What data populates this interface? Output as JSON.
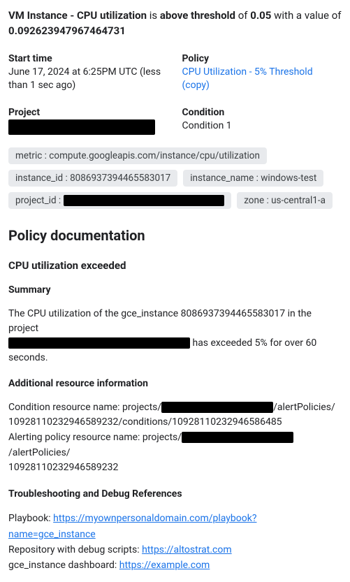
{
  "headline": {
    "metric_name": "VM Instance - CPU utilization",
    "verb": "is",
    "state": "above threshold",
    "of": "of",
    "threshold": "0.05",
    "with": "with a value of",
    "value": "0.092623947967464731"
  },
  "meta": {
    "start_time_label": "Start time",
    "start_time_value": "June 17, 2024 at 6:25PM UTC (less than 1 sec ago)",
    "policy_label": "Policy",
    "policy_value": "CPU Utilization - 5% Threshold (copy)",
    "project_label": "Project",
    "condition_label": "Condition",
    "condition_value": "Condition 1"
  },
  "chips": {
    "metric": "metric : compute.googleapis.com/instance/cpu/utilization",
    "instance_id": "instance_id : 8086937394465583017",
    "instance_name": "instance_name : windows-test",
    "project_id_prefix": "project_id :",
    "zone": "zone : us-central1-a"
  },
  "doc": {
    "heading": "Policy documentation",
    "sub": "CPU utilization exceeded",
    "summary_h": "Summary",
    "summary_p1": "The CPU utilization of the gce_instance 8086937394465583017 in the project",
    "summary_p2": "has exceeded 5% for over 60 seconds.",
    "addl_h": "Additional resource information",
    "cond_prefix": "Condition resource name: projects/",
    "cond_mid": "/alertPolicies/",
    "cond_tail": "10928110232946589232/conditions/10928110232946586485",
    "alert_prefix": "Alerting policy resource name: projects/",
    "alert_mid": "/alertPolicies/",
    "alert_tail": "10928110232946589232",
    "troubleshoot_h": "Troubleshooting and Debug References",
    "playbook_label": "Playbook: ",
    "playbook_url": "https://myownpersonaldomain.com/playbook?name=gce_instance",
    "repo_label": "Repository with debug scripts: ",
    "repo_url": "https://altostrat.com",
    "dash_label": "gce_instance dashboard: ",
    "dash_url": "https://example.com"
  }
}
